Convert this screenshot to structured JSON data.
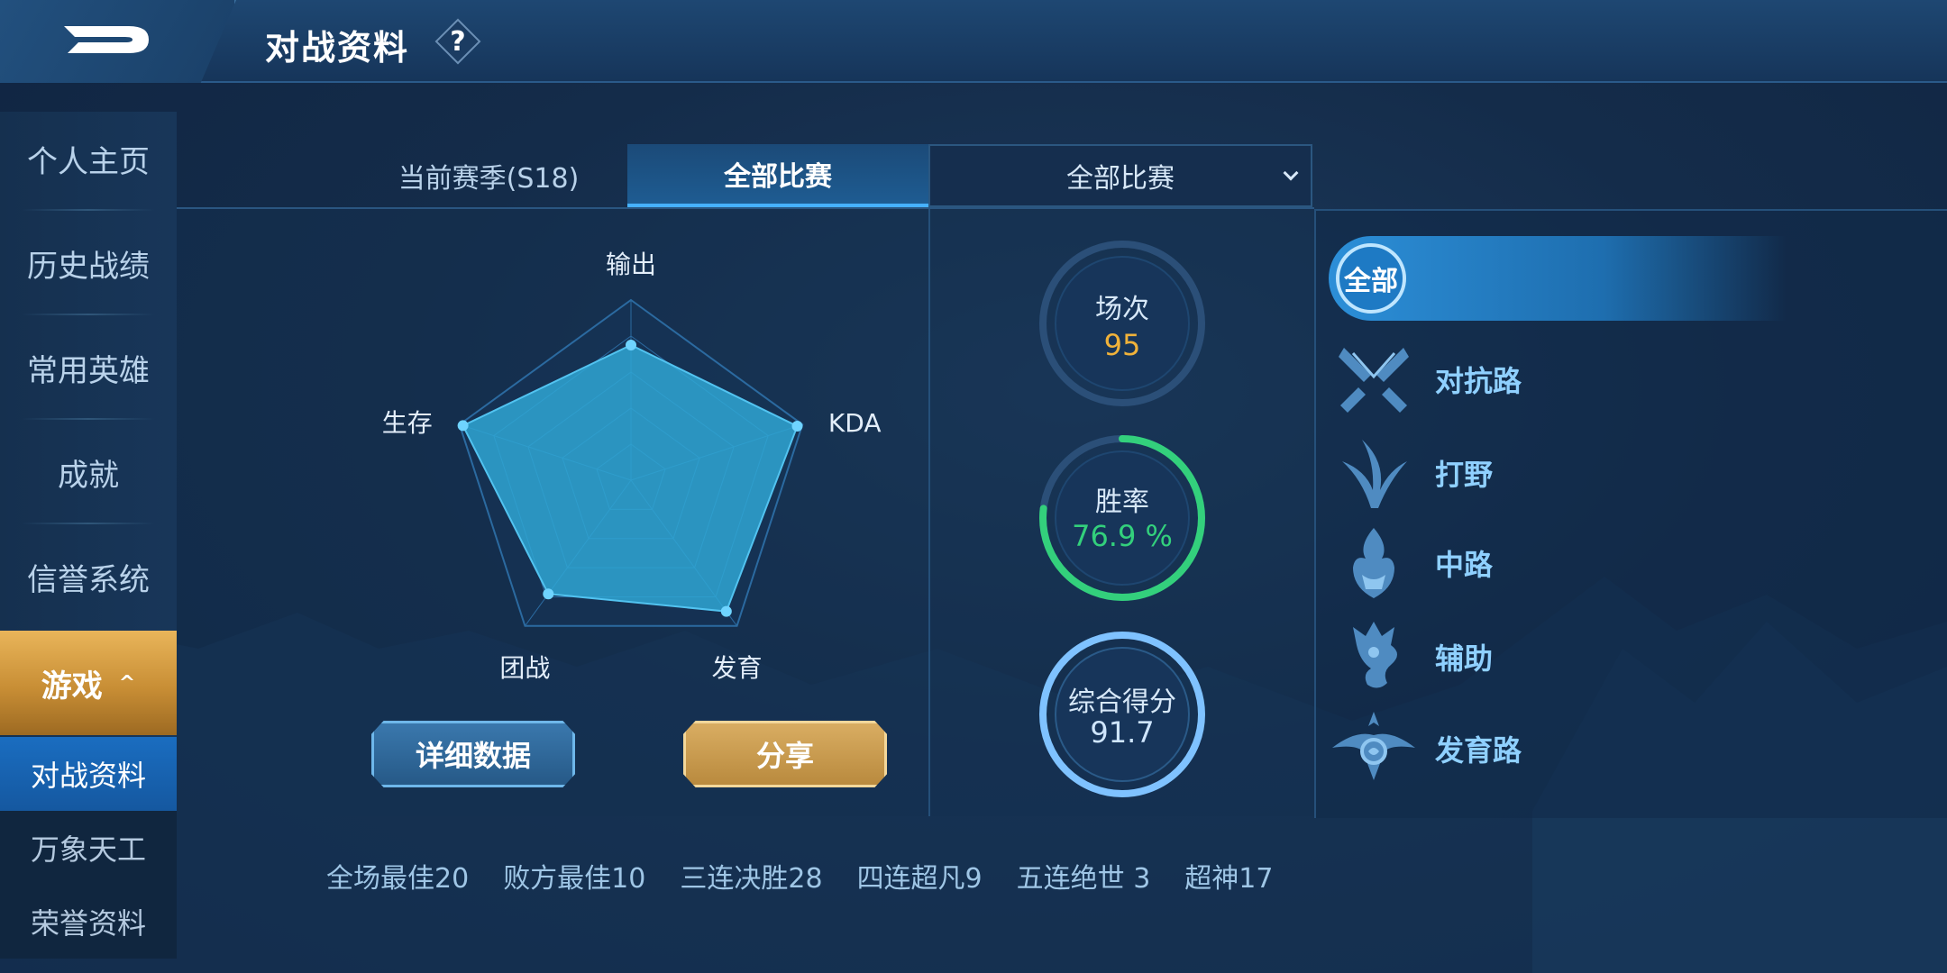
{
  "header": {
    "title": "对战资料",
    "help_label": "?"
  },
  "sidebar": {
    "items": [
      {
        "label": "个人主页"
      },
      {
        "label": "历史战绩"
      },
      {
        "label": "常用英雄"
      },
      {
        "label": "成就"
      },
      {
        "label": "信誉系统"
      },
      {
        "label": "游戏"
      }
    ],
    "sub_items": [
      {
        "label": "对战资料"
      },
      {
        "label": "万象天工"
      },
      {
        "label": "荣誉资料"
      }
    ]
  },
  "tabs": {
    "season": "当前赛季(S18)",
    "all_games": "全部比赛",
    "dropdown_value": "全部比赛"
  },
  "radar": {
    "axes": [
      "输出",
      "KDA",
      "发育",
      "团战",
      "生存"
    ],
    "values": [
      0.75,
      0.97,
      0.9,
      0.78,
      0.98
    ],
    "fill_color": "#2fa6d4",
    "outline_color": "#2b6aa0"
  },
  "buttons": {
    "detail": "详细数据",
    "share": "分享"
  },
  "stats": {
    "matches_label": "场次",
    "matches_value": "95",
    "winrate_label": "胜率",
    "winrate_value": "76.9 %",
    "winrate_fraction": 0.769,
    "score_label": "综合得分",
    "score_value": "91.7",
    "colors": {
      "matches": "#f0b23a",
      "winrate": "#33d07c",
      "score": "#7fc2ff"
    }
  },
  "positions": {
    "all_label": "全部",
    "items": [
      {
        "label": "对抗路",
        "icon": "crossed-swords-icon"
      },
      {
        "label": "打野",
        "icon": "leaf-claw-icon"
      },
      {
        "label": "中路",
        "icon": "flame-icon"
      },
      {
        "label": "辅助",
        "icon": "serpent-crest-icon"
      },
      {
        "label": "发育路",
        "icon": "bow-emblem-icon"
      }
    ]
  },
  "bottom_stats": [
    "全场最佳20",
    "败方最佳10",
    "三连决胜28",
    "四连超凡9",
    "五连绝世 3",
    "超神17"
  ]
}
